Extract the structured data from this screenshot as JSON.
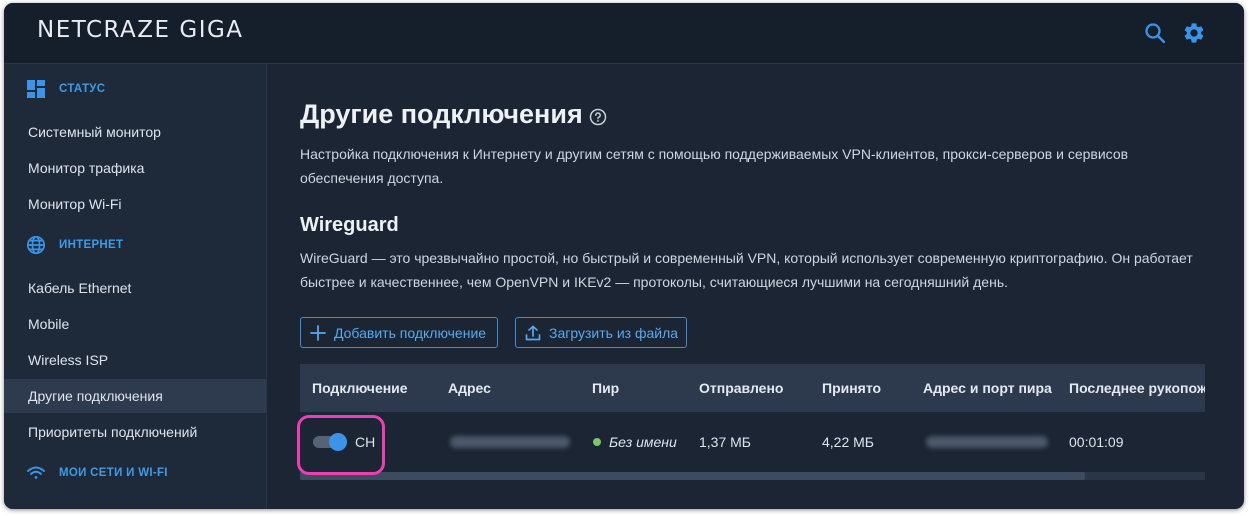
{
  "app": {
    "logo": "NETCRAZE GIGA"
  },
  "header": {
    "search_icon": "search-icon",
    "settings_icon": "gear-icon"
  },
  "sidebar": {
    "sections": [
      {
        "label": "СТАТУС",
        "icon": "dashboard-grid-icon"
      },
      {
        "label": "ИНТЕРНЕТ",
        "icon": "globe-icon"
      },
      {
        "label": "МОИ СЕТИ И WI-FI",
        "icon": "wifi-icon"
      }
    ],
    "items": [
      {
        "label": "Системный монитор"
      },
      {
        "label": "Монитор трафика"
      },
      {
        "label": "Монитор Wi-Fi"
      },
      {
        "label": "Кабель Ethernet"
      },
      {
        "label": "Mobile"
      },
      {
        "label": "Wireless ISP"
      },
      {
        "label": "Другие подключения",
        "active": true
      },
      {
        "label": "Приоритеты подключений"
      }
    ]
  },
  "main": {
    "title": "Другие подключения",
    "description": "Настройка подключения к Интернету и другим сетям с помощью поддерживаемых VPN-клиентов, прокси-серверов и сервисов обеспечения доступа.",
    "wireguard": {
      "title": "Wireguard",
      "description": "WireGuard — это чрезвычайно простой, но быстрый и современный VPN, который использует современную криптографию. Он работает быстрее и качественнее, чем OpenVPN и IKEv2 — протоколы, считающиеся лучшими на сегодняшний день.",
      "add_button": "Добавить подключение",
      "upload_button": "Загрузить из файла"
    },
    "table": {
      "columns": [
        "Подключение",
        "Адрес",
        "Пир",
        "Отправлено",
        "Принято",
        "Адрес и порт пира",
        "Последнее рукопожатие"
      ],
      "rows": [
        {
          "enabled": true,
          "connection": "CH",
          "peer": "Без имени",
          "sent": "1,37 МБ",
          "received": "4,22 МБ",
          "last_handshake": "00:01:09"
        }
      ]
    }
  },
  "colors": {
    "accent": "#3d94e6",
    "highlight": "#ec3fb4",
    "status_ok": "#7ec46a"
  }
}
